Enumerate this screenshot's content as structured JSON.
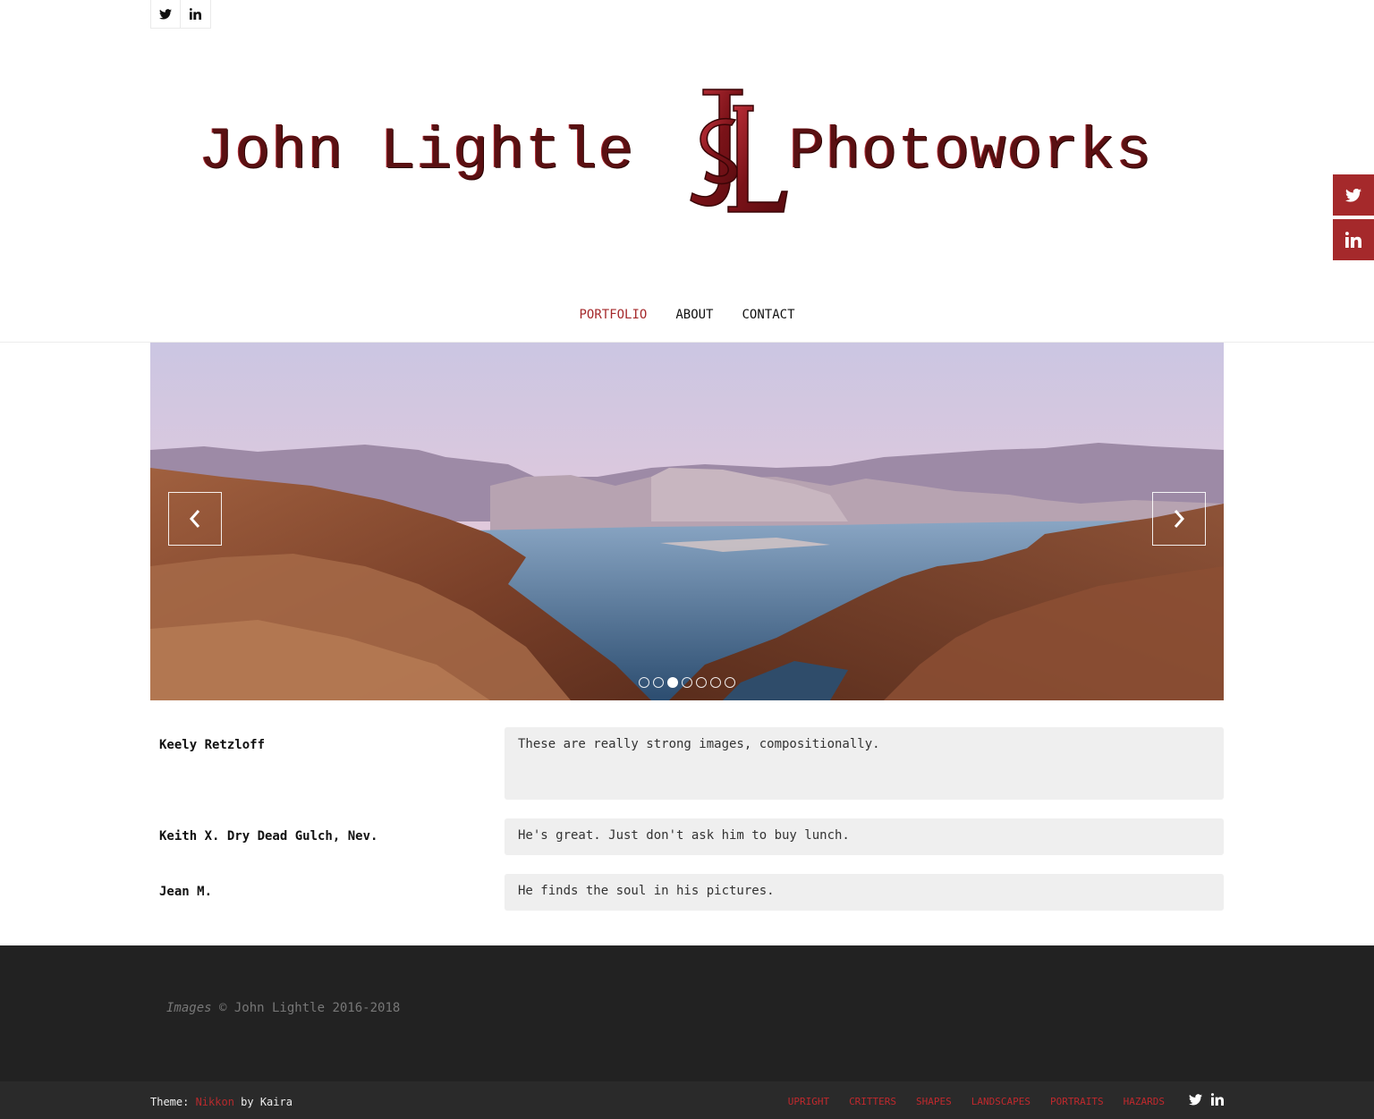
{
  "top_social": {
    "icons": [
      "twitter-icon",
      "linkedin-icon"
    ]
  },
  "logo": {
    "left_word": "John Lightle",
    "right_word": "Photoworks",
    "monogram": "JL"
  },
  "side_social": {
    "icons": [
      "twitter-icon",
      "linkedin-icon"
    ],
    "color": "#a5292b"
  },
  "nav": {
    "items": [
      {
        "label": "PORTFOLIO",
        "active": true
      },
      {
        "label": "ABOUT",
        "active": false
      },
      {
        "label": "CONTACT",
        "active": false
      }
    ]
  },
  "slider": {
    "total_slides": 7,
    "active_slide": 3,
    "prev_icon": "chevron-left-icon",
    "next_icon": "chevron-right-icon"
  },
  "testimonials": [
    {
      "name": "Keely Retzloff",
      "text": "These are really strong images, compositionally."
    },
    {
      "name": "Keith X. Dry Dead Gulch, Nev.",
      "text": "He's great. Just don't ask him to buy lunch."
    },
    {
      "name": "Jean M.",
      "text": "He finds the soul in his pictures."
    }
  ],
  "footer": {
    "copyright_prefix": "Images",
    "copyright_rest": " © John Lightle 2016-2018",
    "theme_label": "Theme: ",
    "theme_name": "Nikkon",
    "theme_suffix": " by Kaira",
    "menu": [
      "UPRIGHT",
      "CRITTERS",
      "SHAPES",
      "LANDSCAPES",
      "PORTRAITS",
      "HAZARDS"
    ]
  },
  "colors": {
    "accent": "#a5292b",
    "footer_bg": "#222222",
    "testimonial_bg": "#efefef"
  }
}
